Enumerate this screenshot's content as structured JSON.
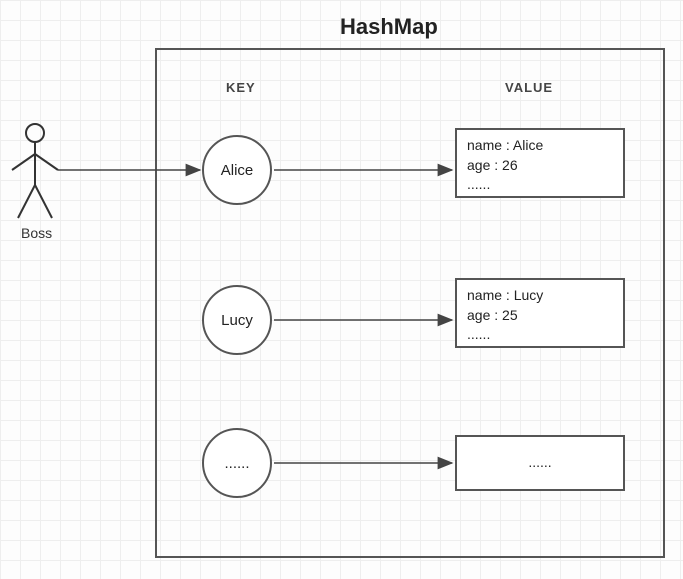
{
  "title": "HashMap",
  "actor": {
    "label": "Boss"
  },
  "columns": {
    "key_header": "KEY",
    "value_header": "VALUE"
  },
  "entries": [
    {
      "key": "Alice",
      "value_lines": [
        "name : Alice",
        "age : 26",
        "......"
      ]
    },
    {
      "key": "Lucy",
      "value_lines": [
        "name : Lucy",
        "age : 25",
        "......"
      ]
    },
    {
      "key": "......",
      "value_lines": [
        "......"
      ]
    }
  ]
}
